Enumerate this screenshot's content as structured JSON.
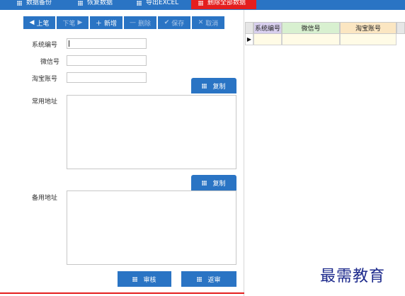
{
  "top_tabs": [
    {
      "label": "数据备份",
      "icon": "grid-icon"
    },
    {
      "label": "恢复数据",
      "icon": "grid-icon"
    },
    {
      "label": "导出EXCEL",
      "icon": "grid-icon"
    },
    {
      "label": "删除全部数据",
      "icon": "grid-icon",
      "active": true
    }
  ],
  "toolbar": {
    "prev": "上笔",
    "next": "下笔",
    "add": "新增",
    "delete": "删除",
    "save": "保存",
    "cancel": "取消"
  },
  "form": {
    "system_id_label": "系统编号",
    "wechat_label": "微信号",
    "taobao_label": "淘宝账号",
    "main_address_label": "常用地址",
    "backup_address_label": "备用地址",
    "copy_label": "复制",
    "system_id_value": "",
    "wechat_value": "",
    "taobao_value": "",
    "main_address_value": "",
    "backup_address_value": ""
  },
  "actions": {
    "approve": "审核",
    "unapprove": "返审"
  },
  "grid": {
    "columns": [
      "系统编号",
      "微信号",
      "淘宝账号"
    ],
    "column_colors": [
      "#d8cfee",
      "#d8f0d0",
      "#fbe6c2"
    ]
  },
  "watermark": "最需教育",
  "colors": {
    "accent_blue": "#2a74c4",
    "danger_red": "#e41e1e"
  }
}
